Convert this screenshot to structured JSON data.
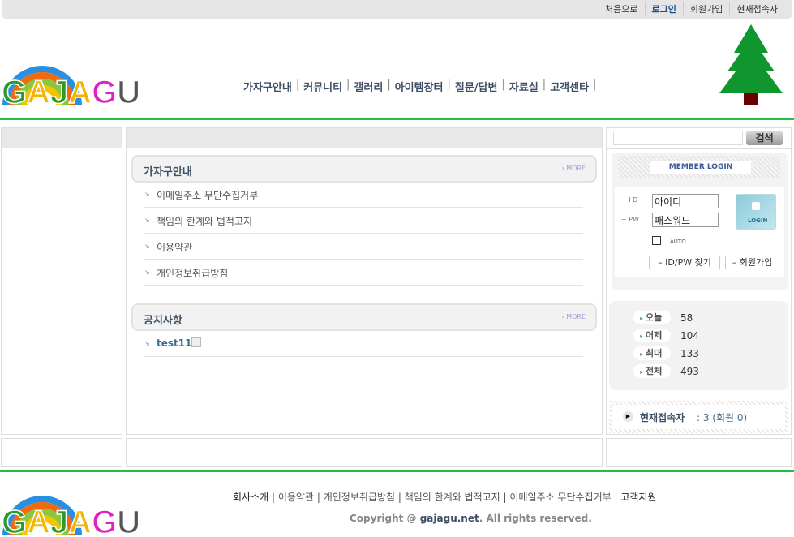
{
  "topnav": [
    "처음으로",
    "로그인",
    "회원가입",
    "현재접속자"
  ],
  "logo_text": "GAJAGU",
  "mainnav": [
    "가자구안내",
    "커뮤니티",
    "갤러리",
    "아이템장터",
    "질문/답변",
    "자료실",
    "고객센타"
  ],
  "search": {
    "button": "검색",
    "value": ""
  },
  "login": {
    "title": "MEMBER LOGIN",
    "id_label": "+ I D",
    "pw_label": "+ PW",
    "id_value": "아이디",
    "pw_value": "패스워드",
    "auto": "AUTO",
    "login_button": "LOGIN",
    "find": "ID/PW 찾기",
    "join": "회원가입"
  },
  "stats": [
    {
      "label": "오늘",
      "value": "58"
    },
    {
      "label": "어제",
      "value": "104"
    },
    {
      "label": "최대",
      "value": "133"
    },
    {
      "label": "전체",
      "value": "493"
    }
  ],
  "current": {
    "label": "현재접속자",
    "value": ": 3 (회원 0)"
  },
  "guide": {
    "title": "가자구안내",
    "more": "MORE",
    "items": [
      "이메일주소 무단수집거부",
      "책임의 한계와 법적고지",
      "이용약관",
      "개인정보취급방침"
    ]
  },
  "notice": {
    "title": "공지사항",
    "more": "MORE",
    "items": [
      "test11"
    ]
  },
  "footer": {
    "links": [
      "회사소개",
      "이용약관",
      "개인정보취급방침",
      "책임의 한계와 법적고지",
      "이메일주소 무단수집거부",
      "고객지원"
    ],
    "copy_pre": "Copyright @ ",
    "copy_site": "gajagu.net",
    "copy_post": ". All rights reserved."
  }
}
